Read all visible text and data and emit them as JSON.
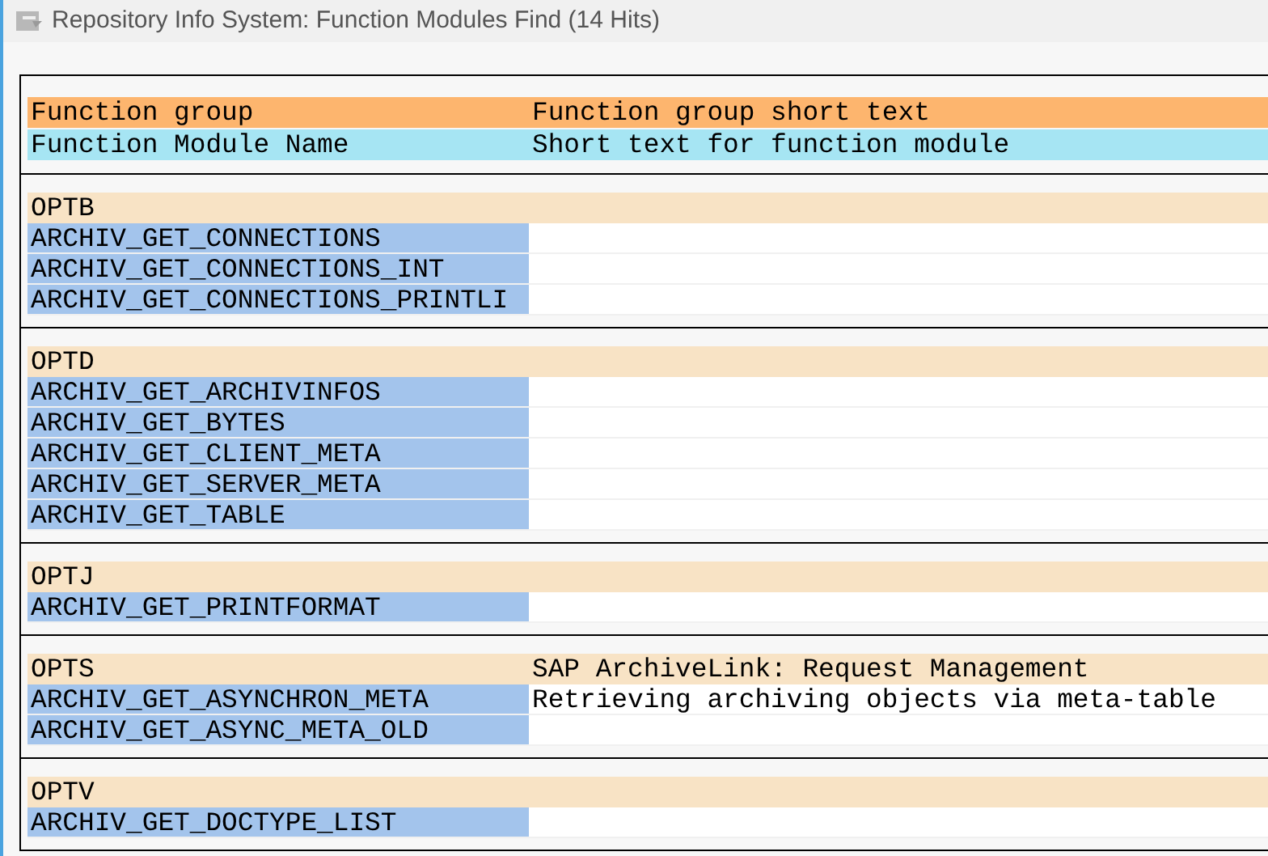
{
  "window": {
    "title": "Repository Info System: Function Modules Find (14 Hits)"
  },
  "legend": {
    "group_label": "Function group",
    "group_text_label": "Function group short text",
    "module_label": "Function Module Name",
    "module_text_label": "Short text for function module"
  },
  "groups": [
    {
      "name": "OPTB",
      "modules": [
        {
          "name": "ARCHIV_GET_CONNECTIONS"
        },
        {
          "name": "ARCHIV_GET_CONNECTIONS_INT"
        },
        {
          "name": "ARCHIV_GET_CONNECTIONS_PRINTLI"
        }
      ]
    },
    {
      "name": "OPTD",
      "modules": [
        {
          "name": "ARCHIV_GET_ARCHIVINFOS"
        },
        {
          "name": "ARCHIV_GET_BYTES"
        },
        {
          "name": "ARCHIV_GET_CLIENT_META"
        },
        {
          "name": "ARCHIV_GET_SERVER_META"
        },
        {
          "name": "ARCHIV_GET_TABLE"
        }
      ]
    },
    {
      "name": "OPTJ",
      "modules": [
        {
          "name": "ARCHIV_GET_PRINTFORMAT"
        }
      ]
    },
    {
      "name": "OPTS",
      "text": "SAP ArchiveLink: Request Management",
      "modules": [
        {
          "name": "ARCHIV_GET_ASYNCHRON_META",
          "text": "Retrieving archiving objects via meta-table"
        },
        {
          "name": "ARCHIV_GET_ASYNC_META_OLD"
        }
      ]
    },
    {
      "name": "OPTV",
      "modules": [
        {
          "name": "ARCHIV_GET_DOCTYPE_LIST"
        }
      ]
    }
  ]
}
